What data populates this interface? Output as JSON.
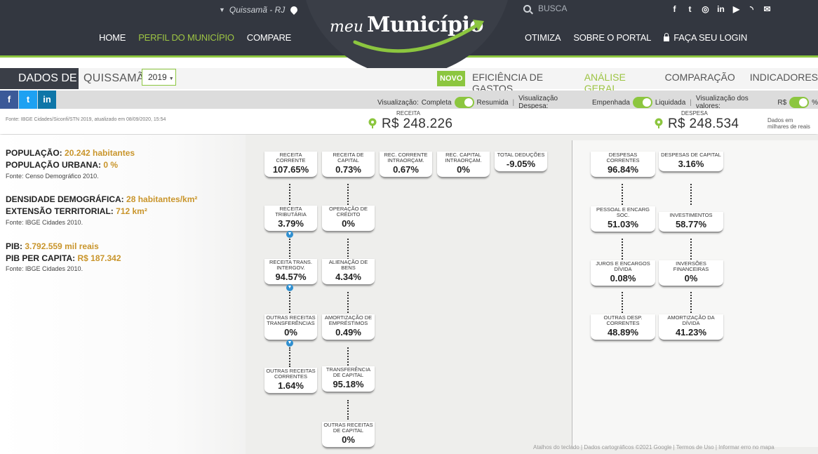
{
  "header": {
    "location": "Quissamã - RJ",
    "logo": {
      "meu": "meu",
      "municipio": "Município"
    },
    "search_placeholder": "BUSCA",
    "social_icons": [
      "f",
      "t",
      "◎",
      "in",
      "▶",
      "◝",
      "✉"
    ],
    "nav_left": [
      "HOME",
      "PERFIL DO MUNICÍPIO",
      "COMPARE"
    ],
    "nav_right": [
      "OTIMIZA",
      "SOBRE O PORTAL",
      "FAÇA SEU LOGIN"
    ]
  },
  "dados": {
    "label": "DADOS DE",
    "city": "QUISSAMÃ",
    "year": "2019",
    "novo": "NOVO",
    "tabs": [
      "EFICIÊNCIA DE GASTOS",
      "ANÁLISE GERAL",
      "COMPARAÇÃO",
      "INDICADORES"
    ]
  },
  "share": [
    "f",
    "t",
    "in"
  ],
  "toggles": {
    "vis": "Visualização:",
    "completa": "Completa",
    "resumida": "Resumida",
    "vis_desp": "Visualização Despesa:",
    "empenhada": "Empenhada",
    "liquidada": "Liquidada",
    "vis_val": "Visualização dos valores:",
    "rs": "R$",
    "pct": "%"
  },
  "summary": {
    "fonte": "Fonte: IBGE Cidades/Siconfi/STN 2019, atualizado em 08/09/2020, 15:54",
    "receita_label": "RECEITA",
    "receita_value": "R$ 248.226",
    "despesa_label": "DESPESA",
    "despesa_value": "R$ 248.534",
    "unit": [
      "Dados em",
      "milhares de reais"
    ]
  },
  "info": {
    "populacao_label": "POPULAÇÃO:",
    "populacao_value": "20.242 habitantes",
    "urbana_label": "POPULAÇÃO URBANA:",
    "urbana_value": "0 %",
    "fonte1": "Fonte: Censo Demográfico 2010.",
    "densidade_label": "DENSIDADE DEMOGRÁFICA:",
    "densidade_value": "28 habitantes/km²",
    "extensao_label": "EXTENSÃO TERRITORIAL:",
    "extensao_value": "712 km²",
    "fonte2": "Fonte: IBGE Cidades 2010.",
    "pib_label": "PIB:",
    "pib_value": "3.792.559 mil reais",
    "pibpc_label": "PIB PER CAPITA:",
    "pibpc_value": "R$ 187.342",
    "fonte3": "Fonte: IBGE Cidades 2010."
  },
  "receita": {
    "top": [
      {
        "label": "RECEITA CORRENTE",
        "value": "107.65%"
      },
      {
        "label": "RECEITA DE CAPITAL",
        "value": "0.73%"
      },
      {
        "label": "REC. CORRENTE INTRAORÇAM.",
        "value": "0.67%"
      },
      {
        "label": "REC. CAPITAL INTRAORÇAM.",
        "value": "0%"
      },
      {
        "label": "TOTAL DEDUÇÕES",
        "value": "-9.05%"
      }
    ],
    "corrente": [
      {
        "label": "RECEITA TRIBUTÁRIA",
        "value": "3.79%"
      },
      {
        "label": "RECEITA TRANS. INTERGOV.",
        "value": "94.57%"
      },
      {
        "label": "OUTRAS RECEITAS TRANSFERÊNCIAS",
        "value": "0%"
      },
      {
        "label": "OUTRAS RECEITAS CORRENTES",
        "value": "1.64%"
      }
    ],
    "capital": [
      {
        "label": "OPERAÇÃO DE CRÉDITO",
        "value": "0%"
      },
      {
        "label": "ALIENAÇÃO DE BENS",
        "value": "4.34%"
      },
      {
        "label": "AMORTIZAÇÃO DE EMPRÉSTIMOS",
        "value": "0.49%"
      },
      {
        "label": "TRANSFERÊNCIA DE CAPITAL",
        "value": "95.18%"
      },
      {
        "label": "OUTRAS RECEITAS DE CAPITAL",
        "value": "0%"
      }
    ]
  },
  "despesa": {
    "top": [
      {
        "label": "DESPESAS CORRENTES",
        "value": "96.84%"
      },
      {
        "label": "DESPESAS DE CAPITAL",
        "value": "3.16%"
      }
    ],
    "correntes": [
      {
        "label": "PESSOAL E ENCARG SOC.",
        "value": "51.03%"
      },
      {
        "label": "JUROS E ENCARGOS DÍVIDA",
        "value": "0.08%"
      },
      {
        "label": "OUTRAS DESP. CORRENTES",
        "value": "48.89%"
      }
    ],
    "capital": [
      {
        "label": "INVESTIMENTOS",
        "value": "58.77%"
      },
      {
        "label": "INVERSÕES FINANCEIRAS",
        "value": "0%"
      },
      {
        "label": "AMORTIZAÇÃO DA DÍVIDA",
        "value": "41.23%"
      }
    ]
  },
  "map_credit": "Atalhos do teclado | Dados cartográficos ©2021 Google | Termos de Uso | Informar erro no mapa"
}
